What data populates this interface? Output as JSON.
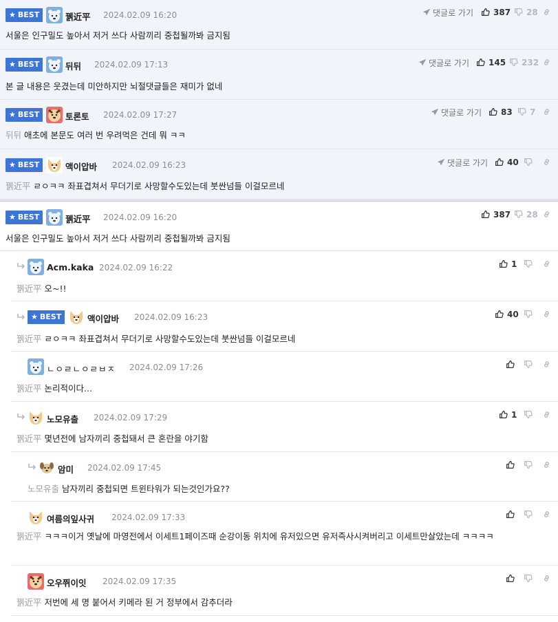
{
  "best_label": "BEST",
  "goto_label": "댓글로 가기",
  "best_comments": [
    {
      "nick": "꿹近平",
      "date": "2024.02.09 16:20",
      "up": "387",
      "down": "28",
      "mention": "",
      "text": "서울은 인구밀도 높아서 저거 쓰다 사람끼리 중첩될까봐 금지됨",
      "avatar": "bear"
    },
    {
      "nick": "뒤뒤",
      "date": "2024.02.09 17:13",
      "up": "145",
      "down": "232",
      "mention": "",
      "text": "본 글 내용은 웃겼는데 미안하지만 뇌절댓글들은 재미가 없네",
      "avatar": "bear"
    },
    {
      "nick": "토론토",
      "date": "2024.02.09 17:27",
      "up": "83",
      "down": "7",
      "mention": "뒤뒤",
      "text": "애초에 본문도 여러 번 우려먹은 건데 뭐 ㅋㅋ",
      "avatar": "dog-red"
    },
    {
      "nick": "액이압바",
      "date": "2024.02.09 16:23",
      "up": "40",
      "down": "",
      "mention": "꿹近平",
      "text": "ㄹㅇㅋㅋ 좌표겹쳐서 무더기로 사망할수도있는데 붓싼넘들 이걸모르네",
      "avatar": "dog"
    }
  ],
  "comments": [
    {
      "nick": "꿹近平",
      "date": "2024.02.09 16:20",
      "up": "387",
      "down": "28",
      "mention": "",
      "text": "서울은 인구밀도 높아서 저거 쓰다 사람끼리 중첩될까봐 금지됨",
      "avatar": "bear"
    },
    {
      "nick": "Acm.kaka",
      "date": "2024.02.09 16:22",
      "up": "1",
      "down": "",
      "mention": "꿹近平",
      "text": "오~!!",
      "avatar": "bear"
    },
    {
      "nick": "액이압바",
      "date": "2024.02.09 16:23",
      "up": "40",
      "down": "",
      "mention": "꿹近平",
      "text": "ㄹㅇㅋㅋ 좌표겹쳐서 무더기로 사망할수도있는데 붓싼넘들 이걸모르네",
      "avatar": "dog"
    },
    {
      "nick": "ㄴㅇㄹㄴㅇㄹㅂㅈ",
      "date": "2024.02.09 17:26",
      "up": "",
      "down": "",
      "mention": "꿹近平",
      "text": "논리적이다...",
      "avatar": "bear"
    },
    {
      "nick": "노모유출",
      "date": "2024.02.09 17:29",
      "up": "1",
      "down": "",
      "mention": "꿹近平",
      "text": "몇년전에 남자끼리 중첩돼서 큰 혼란을 야기함",
      "avatar": "dog"
    },
    {
      "nick": "암미",
      "date": "2024.02.09 17:45",
      "up": "",
      "down": "",
      "mention": "노모유출",
      "text": "남자끼리 중첩되면 트윈타워가 되는것인가요??",
      "avatar": "puppy"
    },
    {
      "nick": "여름의잎사귀",
      "date": "2024.02.09 17:33",
      "up": "",
      "down": "",
      "mention": "꿹近平",
      "text": "ㅋㅋㅋ이거 옛날에 마영전에서 이세트1페이즈때 순강이동 위치에 유저있으면 유저즉사시켜버리고 이세트만살았는데 ㅋㅋㅋㅋ",
      "avatar": "dog"
    },
    {
      "nick": "오우쮜이잇",
      "date": "2024.02.09 17:35",
      "up": "",
      "down": "",
      "mention": "꿹近平",
      "text": "저번에 세 명 붙어서 키메라 된 거 정부에서 감추더라",
      "avatar": "dog-red"
    }
  ],
  "colors": {
    "accent": "#3d75d6",
    "best_bg": "#f1f4fa",
    "muted": "#8a8f96"
  }
}
